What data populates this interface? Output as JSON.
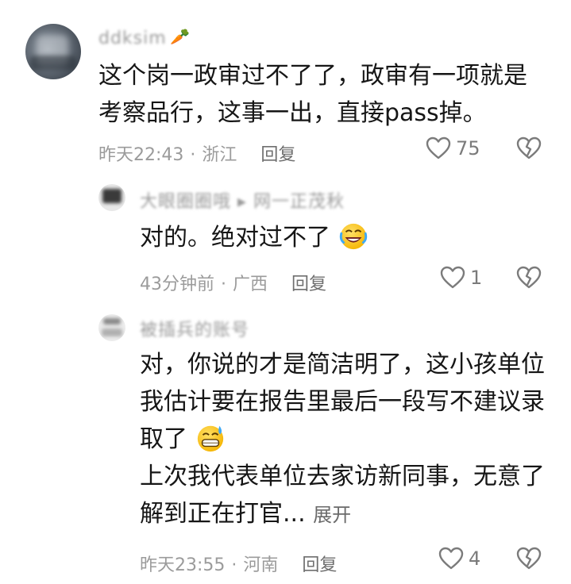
{
  "comments": [
    {
      "username": "ddksim",
      "username_suffix_icon": "carrot-icon",
      "text_lines": [
        "这个岗一政审过不了了，政审有一项就是",
        "考察品行，这事一出，直接pass掉。"
      ],
      "time": "昨天22:43",
      "location": "浙江",
      "reply_label": "回复",
      "like_count": "75"
    }
  ],
  "replies": [
    {
      "username": "大眼圈圈哦 ▸ 网一正茂秋",
      "text": "对的。绝对过不了",
      "emoji": "rofl-emoji",
      "time": "43分钟前",
      "location": "广西",
      "reply_label": "回复",
      "like_count": "1"
    },
    {
      "username": "被插兵的账号",
      "text_lines": [
        "对，你说的才是简洁明了，这小孩单位",
        "我估计要在报告里最后一段写不建议录",
        "取了",
        "上次我代表单位去家访新同事，无意了",
        "解到正在打官..."
      ],
      "emoji": "grin-sweat-emoji",
      "expand_label": "展开",
      "time": "昨天23:55",
      "location": "河南",
      "reply_label": "回复",
      "like_count": "4"
    }
  ],
  "colors": {
    "text": "#161616",
    "meta": "#9b9b9b",
    "icon": "#7b7b7b"
  }
}
